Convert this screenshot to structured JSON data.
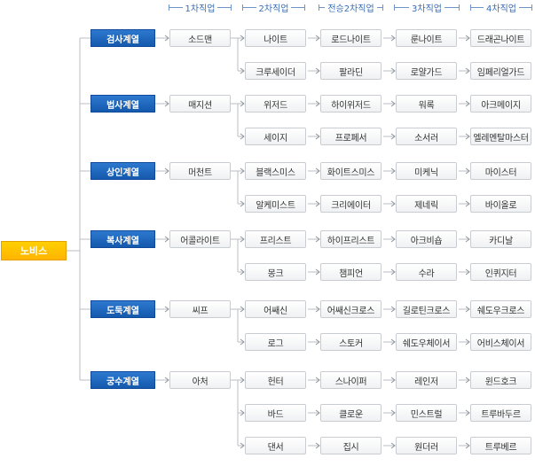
{
  "headers": [
    "1차직업",
    "2차직업",
    "전승2차직업",
    "3차직업",
    "4차직업"
  ],
  "root": "노비스",
  "groups": [
    {
      "name": "검사계열",
      "first": "소드맨",
      "rows": [
        [
          "나이트",
          "로드나이트",
          "룬나이트",
          "드래곤나이트"
        ],
        [
          "크루세이더",
          "팔라딘",
          "로얄가드",
          "임페리얼가드"
        ]
      ]
    },
    {
      "name": "법사계열",
      "first": "매지션",
      "rows": [
        [
          "위저드",
          "하이위저드",
          "워록",
          "아크메이지"
        ],
        [
          "세이지",
          "프로페서",
          "소서러",
          "엘레멘탈마스터"
        ]
      ]
    },
    {
      "name": "상인계열",
      "first": "머천트",
      "rows": [
        [
          "블랙스미스",
          "화이트스미스",
          "미케닉",
          "마이스터"
        ],
        [
          "알케미스트",
          "크리에이터",
          "제네릭",
          "바이올로"
        ]
      ]
    },
    {
      "name": "복사계열",
      "first": "어콜라이트",
      "rows": [
        [
          "프리스트",
          "하이프리스트",
          "아크비숍",
          "카디날"
        ],
        [
          "몽크",
          "챔피언",
          "수라",
          "인퀴지터"
        ]
      ]
    },
    {
      "name": "도둑계열",
      "first": "씨프",
      "rows": [
        [
          "어쌔신",
          "어쌔신크로스",
          "길로틴크로스",
          "쉐도우크로스"
        ],
        [
          "로그",
          "스토커",
          "쉐도우체이서",
          "어비스체이서"
        ]
      ]
    },
    {
      "name": "궁수계열",
      "first": "아처",
      "rows": [
        [
          "헌터",
          "스나이퍼",
          "레인저",
          "윈드호크"
        ],
        [
          "바드",
          "클로운",
          "민스트럴",
          "트루바두르"
        ],
        [
          "댄서",
          "집시",
          "원더러",
          "트루베르"
        ]
      ]
    }
  ]
}
